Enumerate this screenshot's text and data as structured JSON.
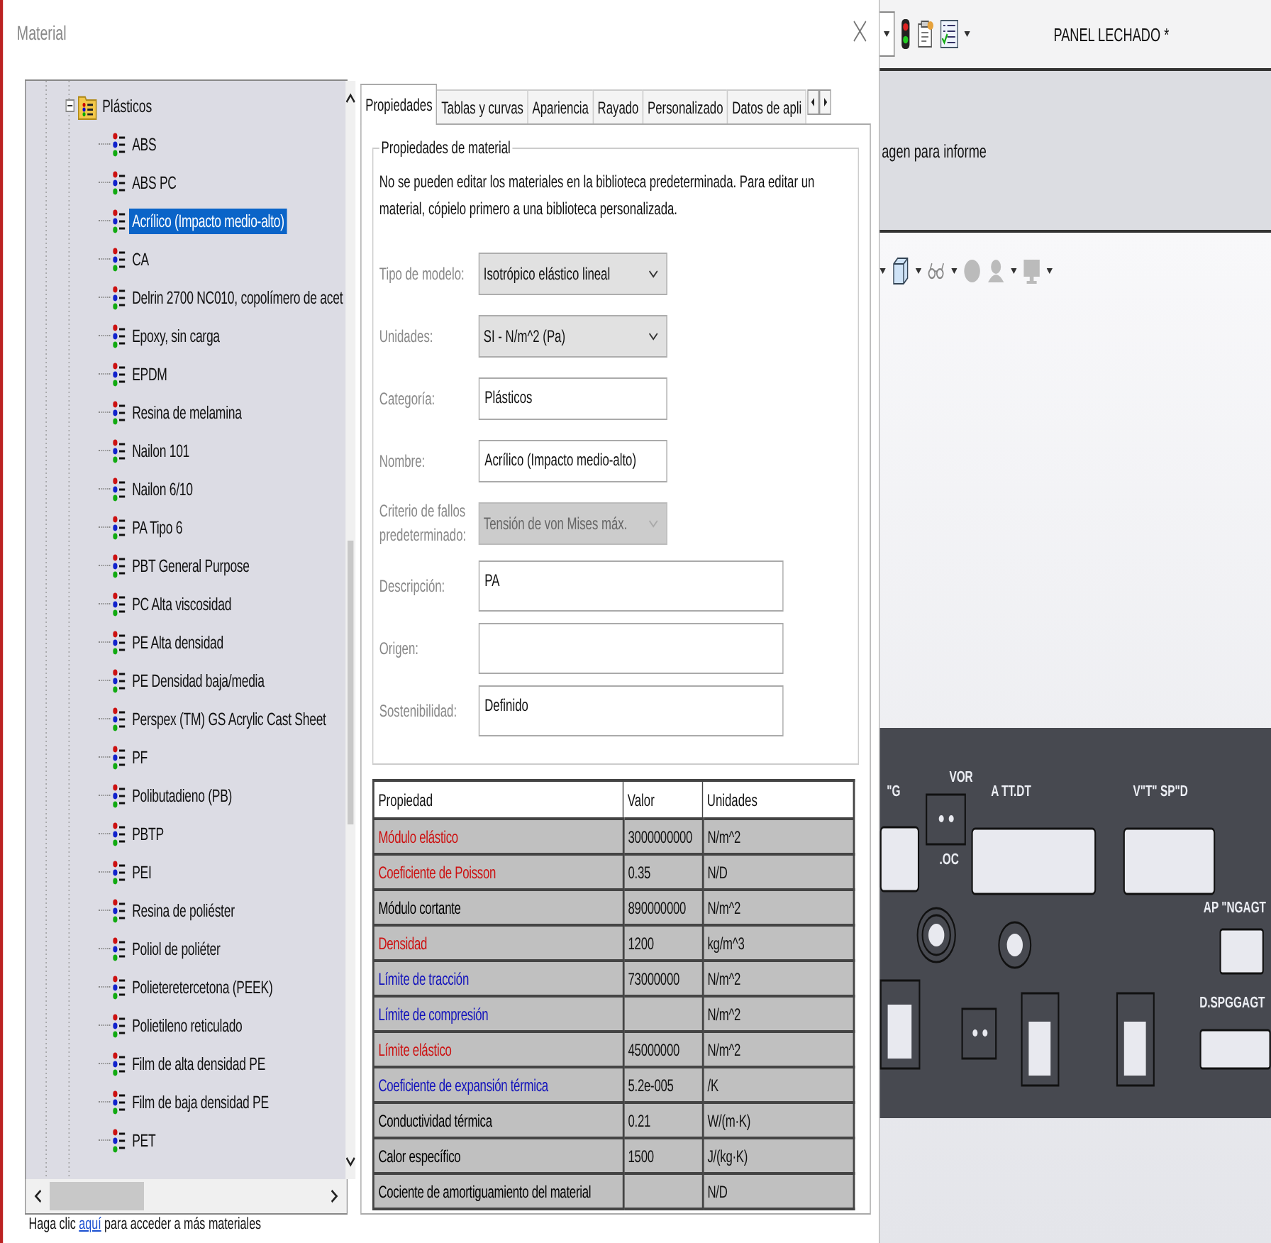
{
  "dialog": {
    "title": "Material",
    "tree": [
      {
        "label": "Plásticos",
        "expanded": true,
        "children": [
          {
            "label": "ABS",
            "selected": false
          },
          {
            "label": "ABS PC",
            "selected": false
          },
          {
            "label": "Acrílico (Impacto medio-alto)",
            "selected": true
          },
          {
            "label": "CA",
            "selected": false
          },
          {
            "label": "Delrin 2700 NC010, copolímero de acet",
            "selected": false
          },
          {
            "label": "Epoxy, sin carga",
            "selected": false
          },
          {
            "label": "EPDM",
            "selected": false
          },
          {
            "label": "Resina de melamina",
            "selected": false
          },
          {
            "label": "Nailon 101",
            "selected": false
          },
          {
            "label": "Nailon 6/10",
            "selected": false
          },
          {
            "label": "PA Tipo 6",
            "selected": false
          },
          {
            "label": "PBT General Purpose",
            "selected": false
          },
          {
            "label": "PC Alta viscosidad",
            "selected": false
          },
          {
            "label": "PE Alta densidad",
            "selected": false
          },
          {
            "label": "PE Densidad baja/media",
            "selected": false
          },
          {
            "label": "Perspex (TM) GS Acrylic Cast Sheet",
            "selected": false
          },
          {
            "label": "PF",
            "selected": false
          },
          {
            "label": "Polibutadieno (PB)",
            "selected": false
          },
          {
            "label": "PBTP",
            "selected": false
          },
          {
            "label": "PEI",
            "selected": false
          },
          {
            "label": "Resina de poliéster",
            "selected": false
          },
          {
            "label": "Poliol de poliéter",
            "selected": false
          },
          {
            "label": "Polieteretercetona (PEEK)",
            "selected": false
          },
          {
            "label": "Polietileno reticulado",
            "selected": false
          },
          {
            "label": "Film de alta densidad PE",
            "selected": false
          },
          {
            "label": "Film de baja densidad PE",
            "selected": false
          },
          {
            "label": "PET",
            "selected": false
          }
        ]
      }
    ],
    "tabs": [
      {
        "label": "Propiedades",
        "selected": true
      },
      {
        "label": "Tablas y curvas",
        "selected": false
      },
      {
        "label": "Apariencia",
        "selected": false
      },
      {
        "label": "Rayado",
        "selected": false
      },
      {
        "label": "Personalizado",
        "selected": false
      },
      {
        "label": "Datos de apli",
        "selected": false
      }
    ],
    "group": {
      "title": "Propiedades de material",
      "note": "No se pueden editar los materiales en la biblioteca predeterminada. Para editar un material, cópielo primero a una biblioteca personalizada.",
      "fields": [
        {
          "label": "Tipo de modelo:",
          "kind": "select",
          "value": "Isotrópico elástico lineal",
          "disabled": false
        },
        {
          "label": "Unidades:",
          "kind": "select",
          "value": "SI - N/m^2 (Pa)",
          "disabled": false
        },
        {
          "label": "Categoría:",
          "kind": "text",
          "value": "Plásticos",
          "disabled": false
        },
        {
          "label": "Nombre:",
          "kind": "text",
          "value": "Acrílico (Impacto medio-alto)",
          "disabled": false
        },
        {
          "label": "Criterio de fallos predeterminado:",
          "kind": "select",
          "value": "Tensión de von Mises máx.",
          "disabled": true
        },
        {
          "label": "Descripción:",
          "kind": "memo",
          "value": "PA",
          "disabled": false
        },
        {
          "label": "Origen:",
          "kind": "memo",
          "disabled": false
        },
        {
          "label": "Sostenibilidad:",
          "kind": "memo",
          "value": "Definido",
          "disabled": false
        }
      ]
    },
    "table": {
      "columns": [
        "Propiedad",
        "Valor",
        "Unidades"
      ],
      "rows": [
        {
          "property": "Módulo elástico",
          "value": "3000000000",
          "units": "N/m^2",
          "color": "#cc1111"
        },
        {
          "property": "Coeficiente de Poisson",
          "value": "0.35",
          "units": "N/D",
          "color": "#cc1111"
        },
        {
          "property": "Módulo cortante",
          "value": "890000000",
          "units": "N/m^2",
          "color": "#000000"
        },
        {
          "property": "Densidad",
          "value": "1200",
          "units": "kg/m^3",
          "color": "#cc1111"
        },
        {
          "property": "Límite de tracción",
          "value": "73000000",
          "units": "N/m^2",
          "color": "#1111bb"
        },
        {
          "property": "Límite de compresión",
          "units": "N/m^2",
          "color": "#1111bb"
        },
        {
          "property": "Límite elástico",
          "value": "45000000",
          "units": "N/m^2",
          "color": "#cc1111"
        },
        {
          "property": "Coeficiente de expansión térmica",
          "value": "5.2e-005",
          "units": "/K",
          "color": "#1111bb"
        },
        {
          "property": "Conductividad térmica",
          "value": "0.21",
          "units": "W/(m·K)",
          "color": "#000000"
        },
        {
          "property": "Calor específico",
          "value": "1500",
          "units": "J/(kg·K)",
          "color": "#000000"
        },
        {
          "property": "Cociente de amortiguamiento del material",
          "units": "N/D",
          "color": "#000000"
        }
      ]
    },
    "footer": {
      "before": "Haga clic",
      "link": "aquí",
      "after": "para acceder a más materiales"
    }
  },
  "cad": {
    "document_title": "PANEL LECHADO *",
    "band_text": "agen para informe",
    "panel_labels": [
      "\"G",
      "VOR",
      ".OC",
      "A TT.DT",
      "V\"T\" SP\"D",
      "AP \"NGAGT",
      "D.SPGGAGT"
    ]
  }
}
